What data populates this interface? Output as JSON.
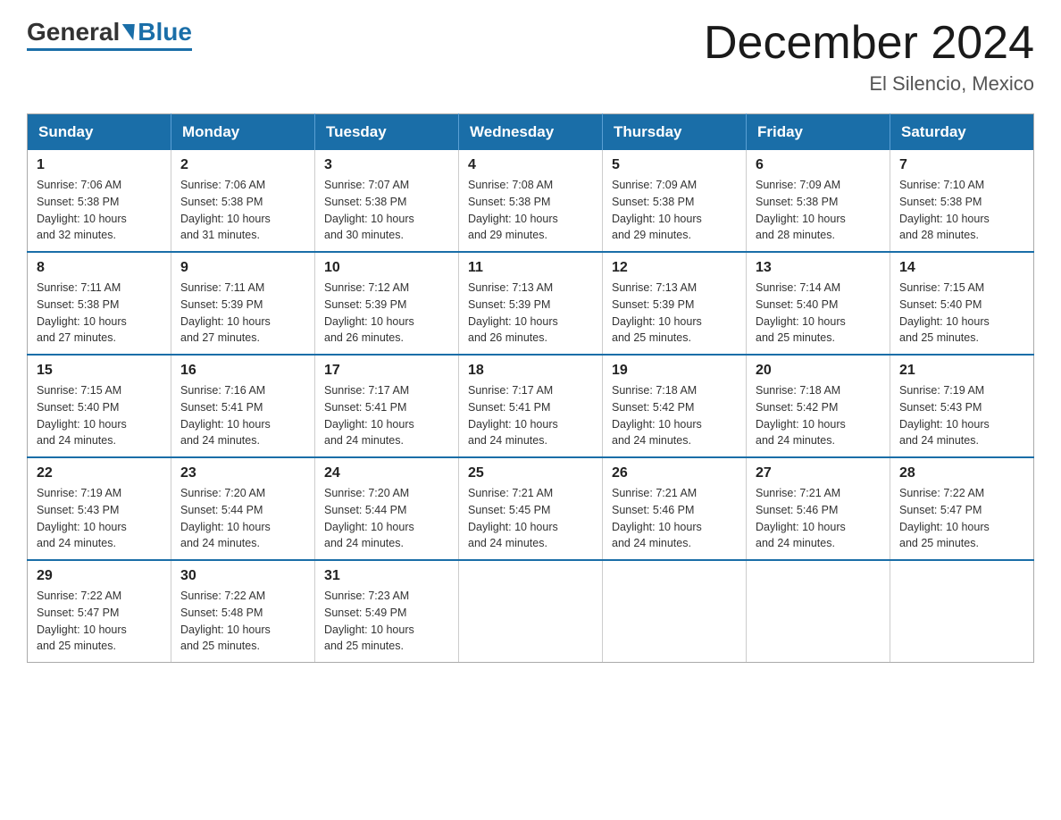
{
  "header": {
    "logo_general": "General",
    "logo_blue": "Blue",
    "month_title": "December 2024",
    "location": "El Silencio, Mexico"
  },
  "days_of_week": [
    "Sunday",
    "Monday",
    "Tuesday",
    "Wednesday",
    "Thursday",
    "Friday",
    "Saturday"
  ],
  "weeks": [
    [
      {
        "day": "1",
        "sunrise": "7:06 AM",
        "sunset": "5:38 PM",
        "daylight": "10 hours and 32 minutes."
      },
      {
        "day": "2",
        "sunrise": "7:06 AM",
        "sunset": "5:38 PM",
        "daylight": "10 hours and 31 minutes."
      },
      {
        "day": "3",
        "sunrise": "7:07 AM",
        "sunset": "5:38 PM",
        "daylight": "10 hours and 30 minutes."
      },
      {
        "day": "4",
        "sunrise": "7:08 AM",
        "sunset": "5:38 PM",
        "daylight": "10 hours and 29 minutes."
      },
      {
        "day": "5",
        "sunrise": "7:09 AM",
        "sunset": "5:38 PM",
        "daylight": "10 hours and 29 minutes."
      },
      {
        "day": "6",
        "sunrise": "7:09 AM",
        "sunset": "5:38 PM",
        "daylight": "10 hours and 28 minutes."
      },
      {
        "day": "7",
        "sunrise": "7:10 AM",
        "sunset": "5:38 PM",
        "daylight": "10 hours and 28 minutes."
      }
    ],
    [
      {
        "day": "8",
        "sunrise": "7:11 AM",
        "sunset": "5:38 PM",
        "daylight": "10 hours and 27 minutes."
      },
      {
        "day": "9",
        "sunrise": "7:11 AM",
        "sunset": "5:39 PM",
        "daylight": "10 hours and 27 minutes."
      },
      {
        "day": "10",
        "sunrise": "7:12 AM",
        "sunset": "5:39 PM",
        "daylight": "10 hours and 26 minutes."
      },
      {
        "day": "11",
        "sunrise": "7:13 AM",
        "sunset": "5:39 PM",
        "daylight": "10 hours and 26 minutes."
      },
      {
        "day": "12",
        "sunrise": "7:13 AM",
        "sunset": "5:39 PM",
        "daylight": "10 hours and 25 minutes."
      },
      {
        "day": "13",
        "sunrise": "7:14 AM",
        "sunset": "5:40 PM",
        "daylight": "10 hours and 25 minutes."
      },
      {
        "day": "14",
        "sunrise": "7:15 AM",
        "sunset": "5:40 PM",
        "daylight": "10 hours and 25 minutes."
      }
    ],
    [
      {
        "day": "15",
        "sunrise": "7:15 AM",
        "sunset": "5:40 PM",
        "daylight": "10 hours and 24 minutes."
      },
      {
        "day": "16",
        "sunrise": "7:16 AM",
        "sunset": "5:41 PM",
        "daylight": "10 hours and 24 minutes."
      },
      {
        "day": "17",
        "sunrise": "7:17 AM",
        "sunset": "5:41 PM",
        "daylight": "10 hours and 24 minutes."
      },
      {
        "day": "18",
        "sunrise": "7:17 AM",
        "sunset": "5:41 PM",
        "daylight": "10 hours and 24 minutes."
      },
      {
        "day": "19",
        "sunrise": "7:18 AM",
        "sunset": "5:42 PM",
        "daylight": "10 hours and 24 minutes."
      },
      {
        "day": "20",
        "sunrise": "7:18 AM",
        "sunset": "5:42 PM",
        "daylight": "10 hours and 24 minutes."
      },
      {
        "day": "21",
        "sunrise": "7:19 AM",
        "sunset": "5:43 PM",
        "daylight": "10 hours and 24 minutes."
      }
    ],
    [
      {
        "day": "22",
        "sunrise": "7:19 AM",
        "sunset": "5:43 PM",
        "daylight": "10 hours and 24 minutes."
      },
      {
        "day": "23",
        "sunrise": "7:20 AM",
        "sunset": "5:44 PM",
        "daylight": "10 hours and 24 minutes."
      },
      {
        "day": "24",
        "sunrise": "7:20 AM",
        "sunset": "5:44 PM",
        "daylight": "10 hours and 24 minutes."
      },
      {
        "day": "25",
        "sunrise": "7:21 AM",
        "sunset": "5:45 PM",
        "daylight": "10 hours and 24 minutes."
      },
      {
        "day": "26",
        "sunrise": "7:21 AM",
        "sunset": "5:46 PM",
        "daylight": "10 hours and 24 minutes."
      },
      {
        "day": "27",
        "sunrise": "7:21 AM",
        "sunset": "5:46 PM",
        "daylight": "10 hours and 24 minutes."
      },
      {
        "day": "28",
        "sunrise": "7:22 AM",
        "sunset": "5:47 PM",
        "daylight": "10 hours and 25 minutes."
      }
    ],
    [
      {
        "day": "29",
        "sunrise": "7:22 AM",
        "sunset": "5:47 PM",
        "daylight": "10 hours and 25 minutes."
      },
      {
        "day": "30",
        "sunrise": "7:22 AM",
        "sunset": "5:48 PM",
        "daylight": "10 hours and 25 minutes."
      },
      {
        "day": "31",
        "sunrise": "7:23 AM",
        "sunset": "5:49 PM",
        "daylight": "10 hours and 25 minutes."
      },
      null,
      null,
      null,
      null
    ]
  ],
  "labels": {
    "sunrise": "Sunrise:",
    "sunset": "Sunset:",
    "daylight": "Daylight:"
  }
}
